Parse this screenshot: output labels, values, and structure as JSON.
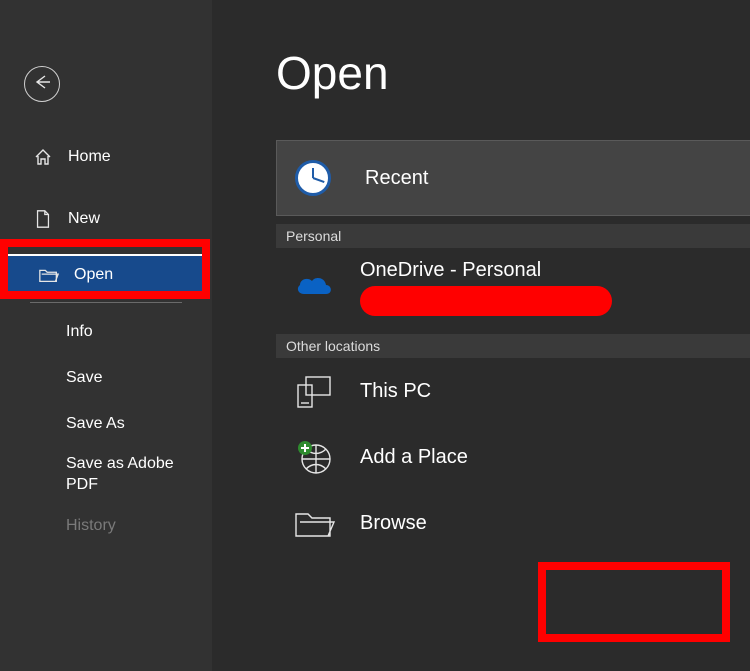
{
  "page": {
    "title": "Open"
  },
  "sidebar": {
    "items": [
      {
        "label": "Home"
      },
      {
        "label": "New"
      },
      {
        "label": "Open"
      }
    ],
    "sub": [
      {
        "label": "Info"
      },
      {
        "label": "Save"
      },
      {
        "label": "Save As"
      },
      {
        "label": "Save as Adobe PDF"
      },
      {
        "label": "History"
      }
    ]
  },
  "locations": {
    "recent": "Recent",
    "group_personal": "Personal",
    "onedrive": "OneDrive - Personal",
    "group_other": "Other locations",
    "thispc": "This PC",
    "addplace": "Add a Place",
    "browse": "Browse"
  }
}
